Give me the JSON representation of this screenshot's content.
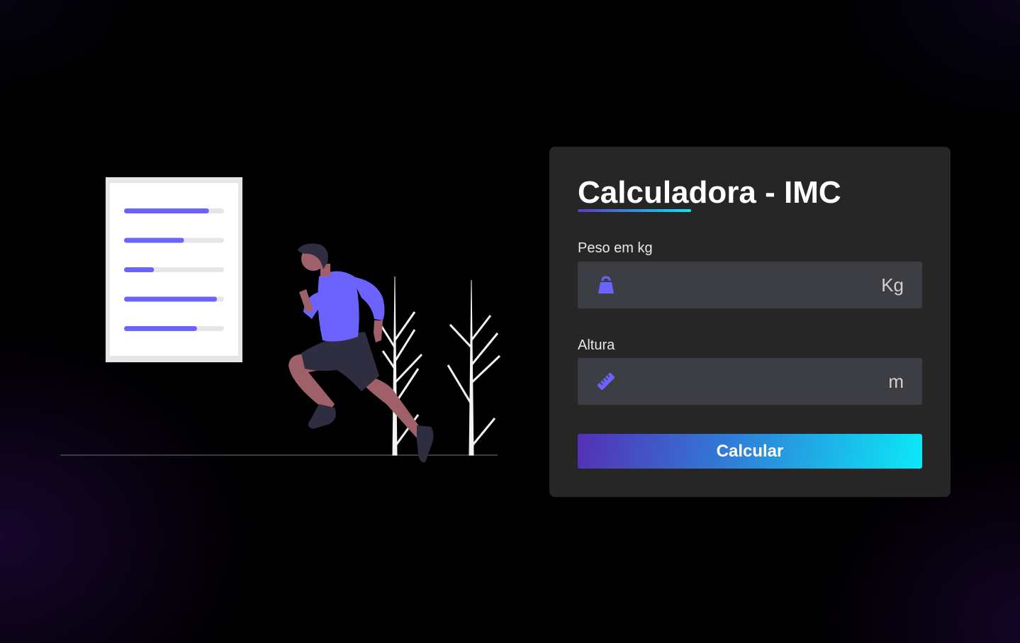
{
  "form": {
    "title": "Calculadora - IMC",
    "weight": {
      "label": "Peso em kg",
      "value": "",
      "placeholder": "",
      "unit": "Kg",
      "icon": "weight-icon"
    },
    "height": {
      "label": "Altura",
      "value": "",
      "placeholder": "",
      "unit": "m",
      "icon": "ruler-icon"
    },
    "submit_label": "Calcular"
  },
  "colors": {
    "background": "#000000",
    "card": "#262626",
    "field": "#3d3e44",
    "accent": "#6c63ff",
    "gradient_start": "#5430b6",
    "gradient_end": "#0be9f7"
  },
  "illustration": {
    "icon": "running-person-illustration",
    "checklist_progress": [
      0.85,
      0.6,
      0.3,
      0.93,
      0.73
    ]
  }
}
